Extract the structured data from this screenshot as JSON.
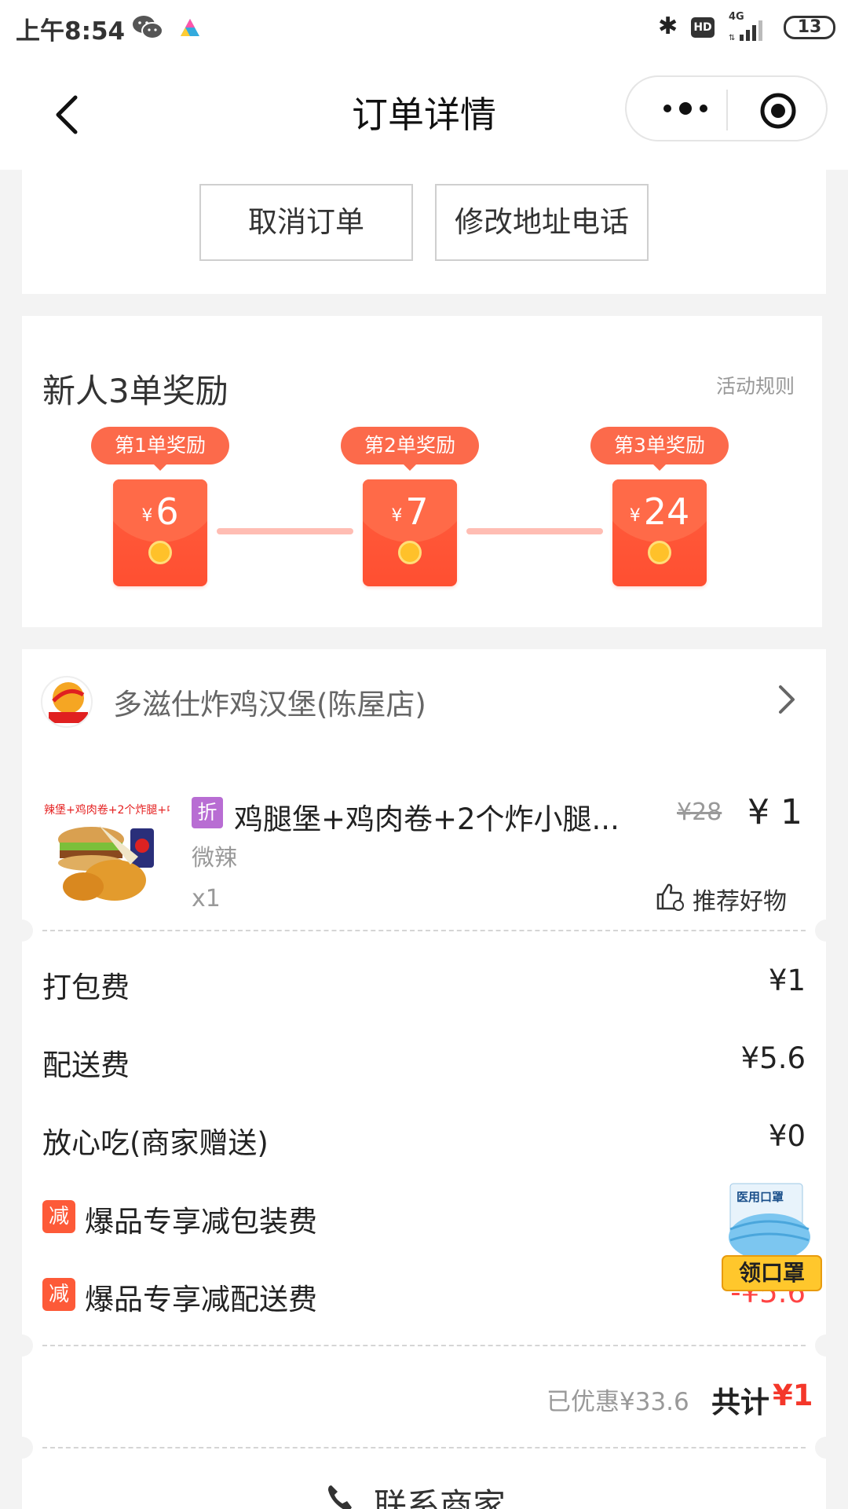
{
  "status_bar": {
    "time": "上午8:54",
    "hd": "HD",
    "network": "4G",
    "battery": "13"
  },
  "nav": {
    "title": "订单详情"
  },
  "actions": {
    "cancel": "取消订单",
    "modify": "修改地址电话"
  },
  "reward": {
    "title": "新人3单奖励",
    "rules": "活动规则",
    "currency": "¥",
    "steps": [
      {
        "label": "第1单奖励",
        "amount": "6"
      },
      {
        "label": "第2单奖励",
        "amount": "7"
      },
      {
        "label": "第3单奖励",
        "amount": "24"
      }
    ]
  },
  "shop": {
    "name": "多滋仕炸鸡汉堡(陈屋店)",
    "logo_text": "多滋仕"
  },
  "item": {
    "badge": "折",
    "name": "鸡腿堡+鸡肉卷+2个炸小腿...",
    "spec": "微辣",
    "quantity": "x1",
    "original_price": "¥28",
    "price": "¥ 1",
    "image_caption": "辣堡+鸡肉卷+2个炸腿+中",
    "recommend": "推荐好物"
  },
  "fees": [
    {
      "label": "打包费",
      "value": "¥1"
    },
    {
      "label": "配送费",
      "value": "¥5.6"
    },
    {
      "label": "放心吃(商家赠送)",
      "value": "¥0"
    }
  ],
  "discounts": [
    {
      "badge": "减",
      "label": "爆品专享减包装费",
      "value": ""
    },
    {
      "badge": "减",
      "label": "爆品专享减配送费",
      "value": "-¥5.6"
    }
  ],
  "summary": {
    "saved": "已优惠¥33.6",
    "total_label": "共计",
    "total_value": "¥1"
  },
  "contact": {
    "label": "联系商家"
  },
  "mask_promo": {
    "top_text": "医用口罩",
    "label": "领口罩"
  },
  "colors": {
    "accent_red": "#fc6a4b",
    "discount_red": "#fd5a38",
    "total_red": "#f4372a",
    "badge_purple": "#b86dd3"
  }
}
